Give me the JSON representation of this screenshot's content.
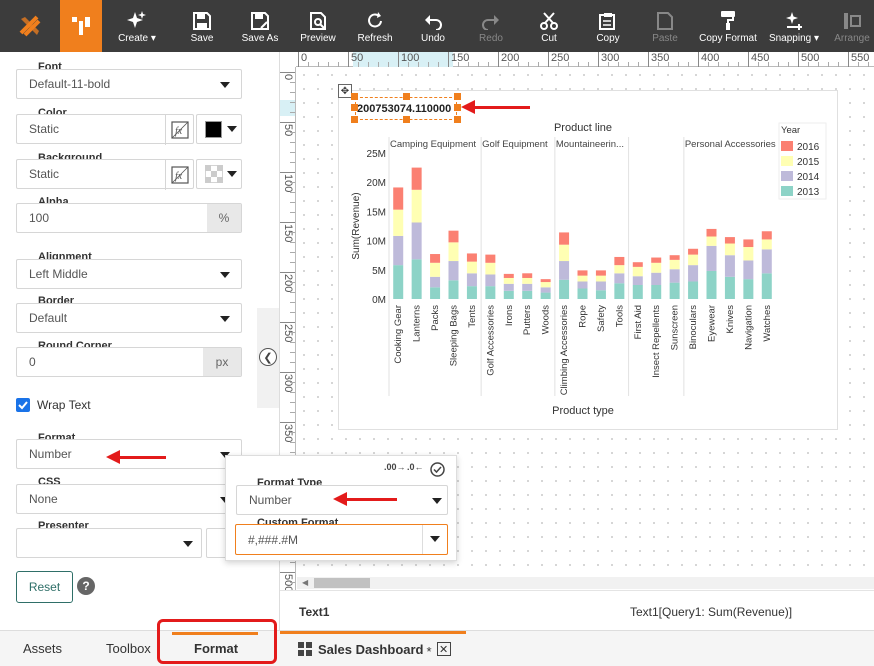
{
  "toolbar": {
    "items": [
      {
        "label": "Create",
        "icon": "sparkle-icon",
        "dropdown": true
      },
      {
        "label": "Save",
        "icon": "save-icon"
      },
      {
        "label": "Save As",
        "icon": "save-as-icon"
      },
      {
        "label": "Preview",
        "icon": "preview-icon"
      },
      {
        "label": "Refresh",
        "icon": "refresh-icon"
      },
      {
        "label": "Undo",
        "icon": "undo-icon"
      },
      {
        "label": "Redo",
        "icon": "redo-icon",
        "disabled": true
      },
      {
        "label": "Cut",
        "icon": "cut-icon"
      },
      {
        "label": "Copy",
        "icon": "copy-icon"
      },
      {
        "label": "Paste",
        "icon": "paste-icon",
        "disabled": true
      },
      {
        "label": "Copy Format",
        "icon": "copy-format-icon"
      },
      {
        "label": "Snapping",
        "icon": "snapping-icon",
        "dropdown": true
      },
      {
        "label": "Arrange",
        "icon": "arrange-icon",
        "disabled": true
      }
    ]
  },
  "format_panel": {
    "font": {
      "label": "Font",
      "value": "Default-11-bold"
    },
    "color": {
      "label": "Color",
      "value": "Static",
      "swatch": "#000000"
    },
    "background": {
      "label": "Background",
      "value": "Static"
    },
    "alpha": {
      "label": "Alpha",
      "value": "100",
      "unit": "%"
    },
    "alignment": {
      "label": "Alignment",
      "value": "Left Middle"
    },
    "border": {
      "label": "Border",
      "value": "Default"
    },
    "round_corner": {
      "label": "Round Corner",
      "value": "0",
      "unit": "px"
    },
    "wrap_text": {
      "label": "Wrap Text",
      "checked": true
    },
    "format": {
      "label": "Format",
      "value": "Number"
    },
    "css": {
      "label": "CSS",
      "value": "None"
    },
    "presenter": {
      "label": "Presenter",
      "value": ""
    },
    "reset_label": "Reset",
    "help_symbol": "?"
  },
  "popup": {
    "format_type_label": "Format Type",
    "format_type_value": "Number",
    "custom_format_label": "Custom Format",
    "custom_format_value": "#,###.#M",
    "inc_decimal": ".00",
    "dec_decimal": ".0"
  },
  "ruler": {
    "top": [
      "0",
      "50",
      "100",
      "150",
      "200",
      "250",
      "300",
      "350",
      "400",
      "450",
      "500",
      "550"
    ],
    "left": [
      "0",
      "50",
      "100",
      "150",
      "200",
      "250",
      "300",
      "350",
      "400",
      "450",
      "500"
    ]
  },
  "canvas": {
    "text_element_value": "200753074.110000"
  },
  "chart_data": {
    "type": "bar",
    "stacked": true,
    "title": "Product line",
    "xlabel": "Product type",
    "ylabel": "Sum(Revenue)",
    "yticks": [
      "0M",
      "5M",
      "10M",
      "15M",
      "20M",
      "25M"
    ],
    "ylim": [
      0,
      25
    ],
    "legend_title": "Year",
    "legend_position": "top-right",
    "groups": [
      {
        "name": "Camping Equipment",
        "categories": [
          "Cooking Gear",
          "Lanterns",
          "Packs",
          "Sleeping Bags",
          "Tents"
        ]
      },
      {
        "name": "Golf Equipment",
        "categories": [
          "Golf Accessories",
          "Irons",
          "Putters",
          "Woods"
        ]
      },
      {
        "name": "Mountaineerin...",
        "categories": [
          "Climbing Accessories",
          "Rope",
          "Safety",
          "Tools"
        ]
      },
      {
        "name": "",
        "categories": [
          "First Aid",
          "Insect Repellents",
          "Sunscreen"
        ]
      },
      {
        "name": "Personal Accessories",
        "categories": [
          "Binoculars",
          "Eyewear",
          "Knives",
          "Navigation",
          "Watches"
        ]
      }
    ],
    "series": [
      {
        "name": "2013",
        "color": "#8dd3c7",
        "values": [
          5.8,
          6.8,
          2.0,
          3.2,
          2.2,
          2.2,
          1.4,
          1.4,
          1.1,
          3.3,
          1.8,
          1.5,
          2.7,
          2.4,
          2.4,
          2.8,
          3.0,
          4.8,
          3.8,
          3.4,
          4.4
        ]
      },
      {
        "name": "2014",
        "color": "#bebada",
        "values": [
          5.0,
          6.3,
          1.8,
          3.3,
          2.2,
          2.0,
          1.2,
          1.2,
          0.9,
          3.2,
          1.2,
          1.5,
          1.7,
          1.5,
          2.1,
          2.3,
          2.8,
          4.3,
          3.7,
          3.2,
          4.1
        ]
      },
      {
        "name": "2015",
        "color": "#ffffb3",
        "values": [
          4.5,
          5.6,
          2.4,
          3.2,
          2.0,
          2.0,
          1.0,
          1.0,
          0.9,
          2.8,
          1.0,
          1.0,
          1.4,
          1.6,
          1.7,
          1.6,
          1.8,
          1.6,
          2.0,
          2.3,
          1.7
        ]
      },
      {
        "name": "2016",
        "color": "#fb8072",
        "values": [
          3.8,
          3.8,
          1.5,
          2.0,
          1.4,
          1.4,
          0.7,
          0.8,
          0.5,
          2.1,
          0.9,
          0.9,
          1.4,
          0.8,
          0.9,
          0.8,
          1.0,
          1.3,
          1.1,
          1.3,
          1.4
        ]
      }
    ],
    "legend_order": [
      "2016",
      "2015",
      "2014",
      "2013"
    ]
  },
  "status": {
    "element_name": "Text1",
    "element_binding": "Text1[Query1: Sum(Revenue)]"
  },
  "bottom_tabs": {
    "assets": "Assets",
    "toolbox": "Toolbox",
    "format": "Format",
    "dashboard": "Sales Dashboard",
    "dashboard_modified": "*"
  },
  "colors": {
    "accent": "#f07f1d",
    "highlight": "#e31b1b",
    "toolbar_bg": "#3c3c3c"
  }
}
